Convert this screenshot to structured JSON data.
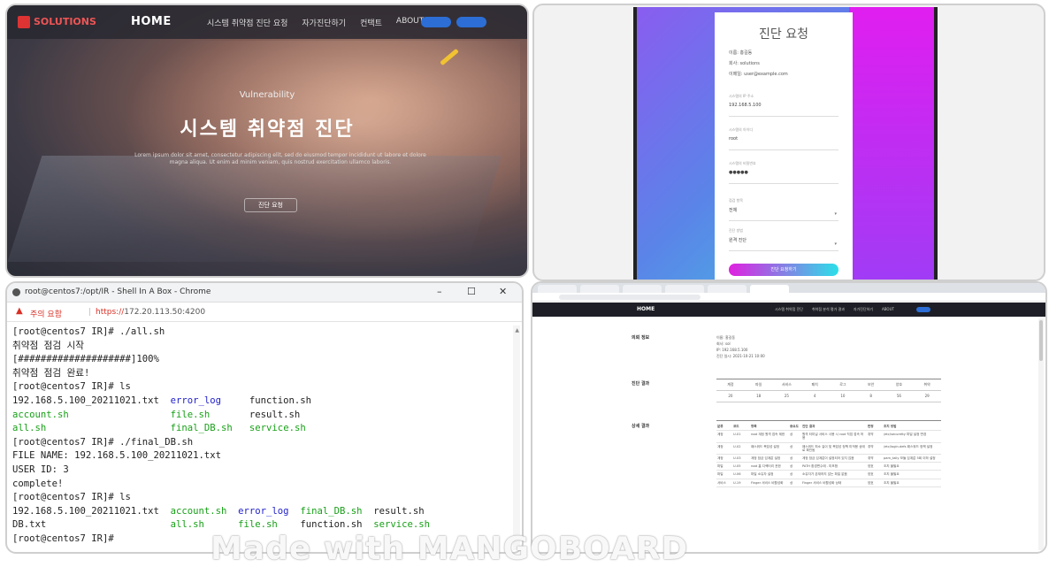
{
  "hero": {
    "logo_text": "SOLUTIONS",
    "brand": "HOME",
    "nav": [
      "시스템 취약점 진단 요청",
      "자가진단하기",
      "컨택트",
      "ABOUT"
    ],
    "subhead": "Vulnerability",
    "headline": "시스템 취약점 진단",
    "description": "Lorem ipsum dolor sit amet, consectetur adipiscing elit, sed do eiusmod tempor incididunt ut labore et dolore magna aliqua. Ut enim ad minim veniam, quis nostrud exercitation ullamco laboris.",
    "cta": "진단 요청"
  },
  "form": {
    "title": "진단 요청",
    "lines": [
      "이름: 홍길동",
      "회사: solutions",
      "이메일: user@example.com"
    ],
    "fields": [
      {
        "label": "시스템의 IP 주소",
        "value": "192.168.5.100"
      },
      {
        "label": "시스템의 아이디",
        "value": "root"
      },
      {
        "label": "시스템의 비밀번호",
        "value": "●●●●●"
      },
      {
        "label": "점검 항목",
        "value": "전체"
      },
      {
        "label": "진단 방법",
        "value": "원격 진단"
      }
    ],
    "submit": "진단 요청하기"
  },
  "terminal": {
    "window_title": "root@centos7:/opt/IR - Shell In A Box - Chrome",
    "warning": "주의 요함",
    "url_scheme": "https://",
    "url_rest": "172.20.113.50:4200",
    "lines": [
      [
        {
          "t": "[root@centos7 IR]# ./all.sh"
        }
      ],
      [
        {
          "t": "취약점 점검 시작"
        }
      ],
      [
        {
          "t": "[####################]100%"
        }
      ],
      [
        {
          "t": "취약점 점검 완료!"
        }
      ],
      [
        {
          "t": "[root@centos7 IR]# ls"
        }
      ],
      [
        {
          "t": "192.168.5.100_20211021.txt  "
        },
        {
          "t": "error_log",
          "c": "c-blue"
        },
        {
          "t": "     function.sh"
        }
      ],
      [
        {
          "t": "account.sh",
          "c": "c-green"
        },
        {
          "t": "                  "
        },
        {
          "t": "file.sh",
          "c": "c-green"
        },
        {
          "t": "       result.sh"
        }
      ],
      [
        {
          "t": "all.sh",
          "c": "c-green"
        },
        {
          "t": "                      "
        },
        {
          "t": "final_DB.sh",
          "c": "c-green"
        },
        {
          "t": "   "
        },
        {
          "t": "service.sh",
          "c": "c-green"
        }
      ],
      [
        {
          "t": "[root@centos7 IR]# ./final_DB.sh"
        }
      ],
      [
        {
          "t": "FILE NAME: 192.168.5.100_20211021.txt"
        }
      ],
      [
        {
          "t": "USER ID: 3"
        }
      ],
      [
        {
          "t": "complete!"
        }
      ],
      [
        {
          "t": "[root@centos7 IR]# ls"
        }
      ],
      [
        {
          "t": "192.168.5.100_20211021.txt  "
        },
        {
          "t": "account.sh",
          "c": "c-green"
        },
        {
          "t": "  "
        },
        {
          "t": "error_log",
          "c": "c-blue"
        },
        {
          "t": "  "
        },
        {
          "t": "final_DB.sh",
          "c": "c-green"
        },
        {
          "t": "  result.sh"
        }
      ],
      [
        {
          "t": "DB.txt                      "
        },
        {
          "t": "all.sh",
          "c": "c-green"
        },
        {
          "t": "      "
        },
        {
          "t": "file.sh",
          "c": "c-green"
        },
        {
          "t": "    function.sh  "
        },
        {
          "t": "service.sh",
          "c": "c-green"
        }
      ],
      [
        {
          "t": "[root@centos7 IR]# "
        }
      ]
    ]
  },
  "report": {
    "brand": "HOME",
    "nav": [
      "시스템 취약점 진단",
      "취약점 분석 평가 결과",
      "자가진단하기",
      "ABOUT"
    ],
    "sections": [
      "의뢰 정보",
      "진단 결과",
      "상세 결과"
    ],
    "info_lines": [
      "이름: 홍길동",
      "회사: sol",
      "IP: 192.168.5.100",
      "진단 일시: 2021-10-21 10:00"
    ],
    "summary_headers": [
      "계정",
      "파일",
      "서비스",
      "패치",
      "로그",
      "보안",
      "양호",
      "취약"
    ],
    "summary_values": [
      "20",
      "18",
      "25",
      "4",
      "10",
      "8",
      "56",
      "29"
    ],
    "detail_headers": [
      "분류",
      "코드",
      "항목",
      "중요도",
      "진단 결과",
      "판정",
      "조치 방법"
    ],
    "detail_rows": [
      [
        "계정",
        "U-01",
        "root 계정 원격 접속 제한",
        "상",
        "원격 터미널 서비스 사용 시 root 직접 접속 허용",
        "취약",
        "/etc/securetty 파일 설정 변경"
      ],
      [
        "계정",
        "U-02",
        "패스워드 복잡성 설정",
        "상",
        "패스워드 최소 길이 및 복잡성 정책 미적용 상태로 확인됨",
        "취약",
        "/etc/login.defs 패스워드 정책 설정"
      ],
      [
        "계정",
        "U-03",
        "계정 잠금 임계값 설정",
        "상",
        "계정 잠금 임계값이 설정되어 있지 않음",
        "취약",
        "pam_tally 모듈 임계값 5회 이하 설정"
      ],
      [
        "파일",
        "U-05",
        "root 홈 디렉터리 권한",
        "상",
        "PATH 환경변수에 . 미포함",
        "양호",
        "조치 불필요"
      ],
      [
        "파일",
        "U-06",
        "파일 소유자 설정",
        "상",
        "소유자가 존재하지 않는 파일 없음",
        "양호",
        "조치 불필요"
      ],
      [
        "서비스",
        "U-19",
        "Finger 서비스 비활성화",
        "상",
        "Finger 서비스 비활성화 상태",
        "양호",
        "조치 불필요"
      ]
    ]
  },
  "watermark": "Made with MANGOBOARD"
}
